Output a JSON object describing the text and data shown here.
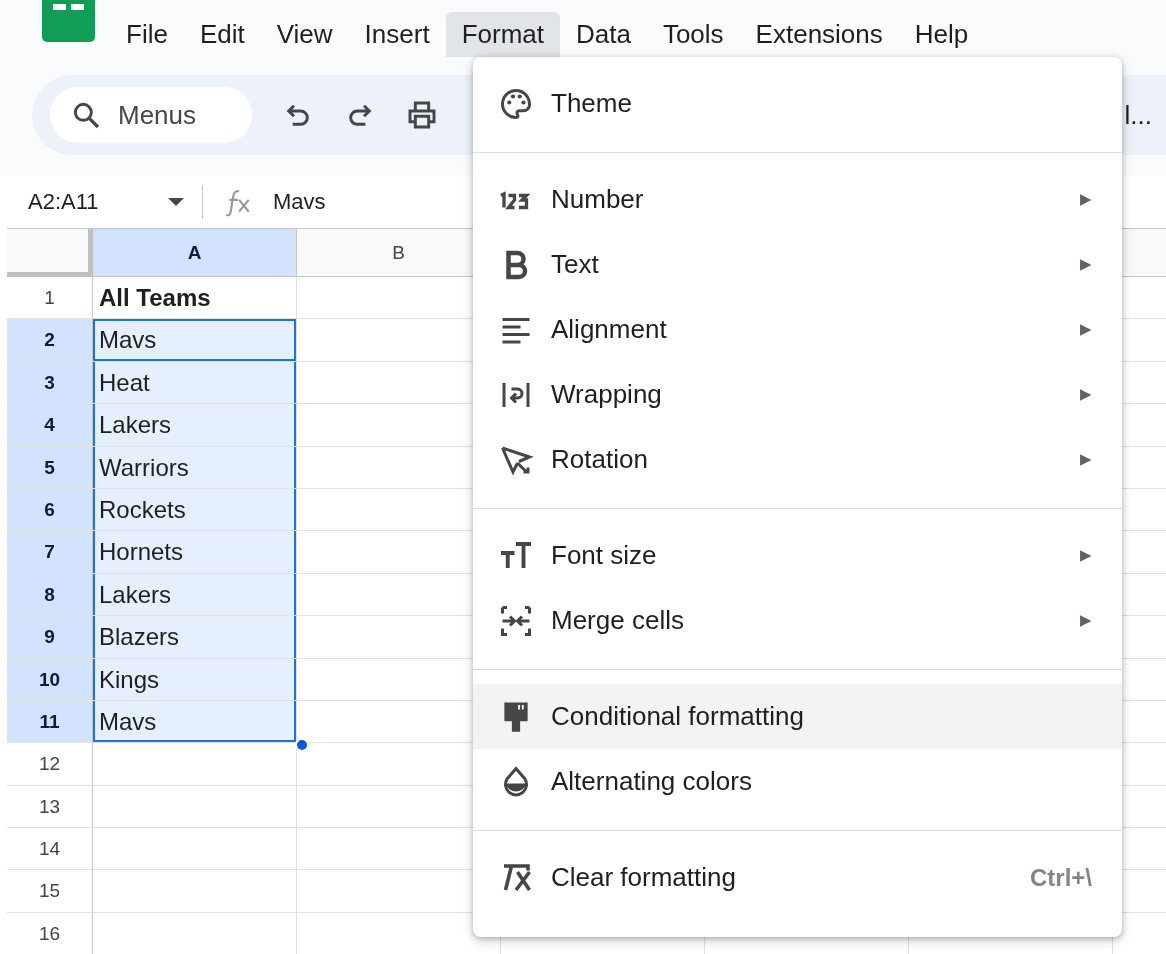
{
  "menubar": [
    {
      "label": "File",
      "selected": false
    },
    {
      "label": "Edit",
      "selected": false
    },
    {
      "label": "View",
      "selected": false
    },
    {
      "label": "Insert",
      "selected": false
    },
    {
      "label": "Format",
      "selected": true
    },
    {
      "label": "Data",
      "selected": false
    },
    {
      "label": "Tools",
      "selected": false
    },
    {
      "label": "Extensions",
      "selected": false
    },
    {
      "label": "Help",
      "selected": false
    }
  ],
  "toolbar": {
    "search_placeholder": "Menus",
    "overflow_text": "l..."
  },
  "formula_bar": {
    "name_box": "A2:A11",
    "formula": "Mavs"
  },
  "columns": [
    {
      "label": "A",
      "selected": true
    },
    {
      "label": "B",
      "selected": false
    }
  ],
  "rows": [
    {
      "number": "1",
      "selected": false,
      "cells": [
        {
          "text": "All Teams",
          "bold": true,
          "active": false
        }
      ]
    },
    {
      "number": "2",
      "selected": true,
      "cells": [
        {
          "text": "Mavs",
          "bold": false,
          "active": true
        }
      ]
    },
    {
      "number": "3",
      "selected": true,
      "cells": [
        {
          "text": "Heat",
          "bold": false,
          "active": false
        }
      ]
    },
    {
      "number": "4",
      "selected": true,
      "cells": [
        {
          "text": "Lakers",
          "bold": false,
          "active": false
        }
      ]
    },
    {
      "number": "5",
      "selected": true,
      "cells": [
        {
          "text": "Warriors",
          "bold": false,
          "active": false
        }
      ]
    },
    {
      "number": "6",
      "selected": true,
      "cells": [
        {
          "text": "Rockets",
          "bold": false,
          "active": false
        }
      ]
    },
    {
      "number": "7",
      "selected": true,
      "cells": [
        {
          "text": "Hornets",
          "bold": false,
          "active": false
        }
      ]
    },
    {
      "number": "8",
      "selected": true,
      "cells": [
        {
          "text": "Lakers",
          "bold": false,
          "active": false
        }
      ]
    },
    {
      "number": "9",
      "selected": true,
      "cells": [
        {
          "text": "Blazers",
          "bold": false,
          "active": false
        }
      ]
    },
    {
      "number": "10",
      "selected": true,
      "cells": [
        {
          "text": "Kings",
          "bold": false,
          "active": false
        }
      ]
    },
    {
      "number": "11",
      "selected": true,
      "cells": [
        {
          "text": "Mavs",
          "bold": false,
          "active": false
        }
      ]
    },
    {
      "number": "12",
      "selected": false,
      "cells": []
    },
    {
      "number": "13",
      "selected": false,
      "cells": []
    },
    {
      "number": "14",
      "selected": false,
      "cells": []
    },
    {
      "number": "15",
      "selected": false,
      "cells": []
    },
    {
      "number": "16",
      "selected": false,
      "cells": []
    }
  ],
  "format_menu": {
    "sections": [
      [
        {
          "label": "Theme",
          "highlighted": false
        }
      ],
      [
        {
          "label": "Number",
          "arrow": "▶",
          "highlighted": false
        },
        {
          "label": "Text",
          "arrow": "▶",
          "highlighted": false
        },
        {
          "label": "Alignment",
          "arrow": "▶",
          "highlighted": false
        },
        {
          "label": "Wrapping",
          "arrow": "▶",
          "highlighted": false
        },
        {
          "label": "Rotation",
          "arrow": "▶",
          "highlighted": false
        }
      ],
      [
        {
          "label": "Font size",
          "arrow": "▶",
          "highlighted": false
        },
        {
          "label": "Merge cells",
          "arrow": "▶",
          "highlighted": false
        }
      ],
      [
        {
          "label": "Conditional formatting",
          "highlighted": true
        },
        {
          "label": "Alternating colors",
          "highlighted": false
        }
      ],
      [
        {
          "label": "Clear formatting",
          "shortcut": "Ctrl+\\",
          "highlighted": false
        }
      ]
    ]
  }
}
